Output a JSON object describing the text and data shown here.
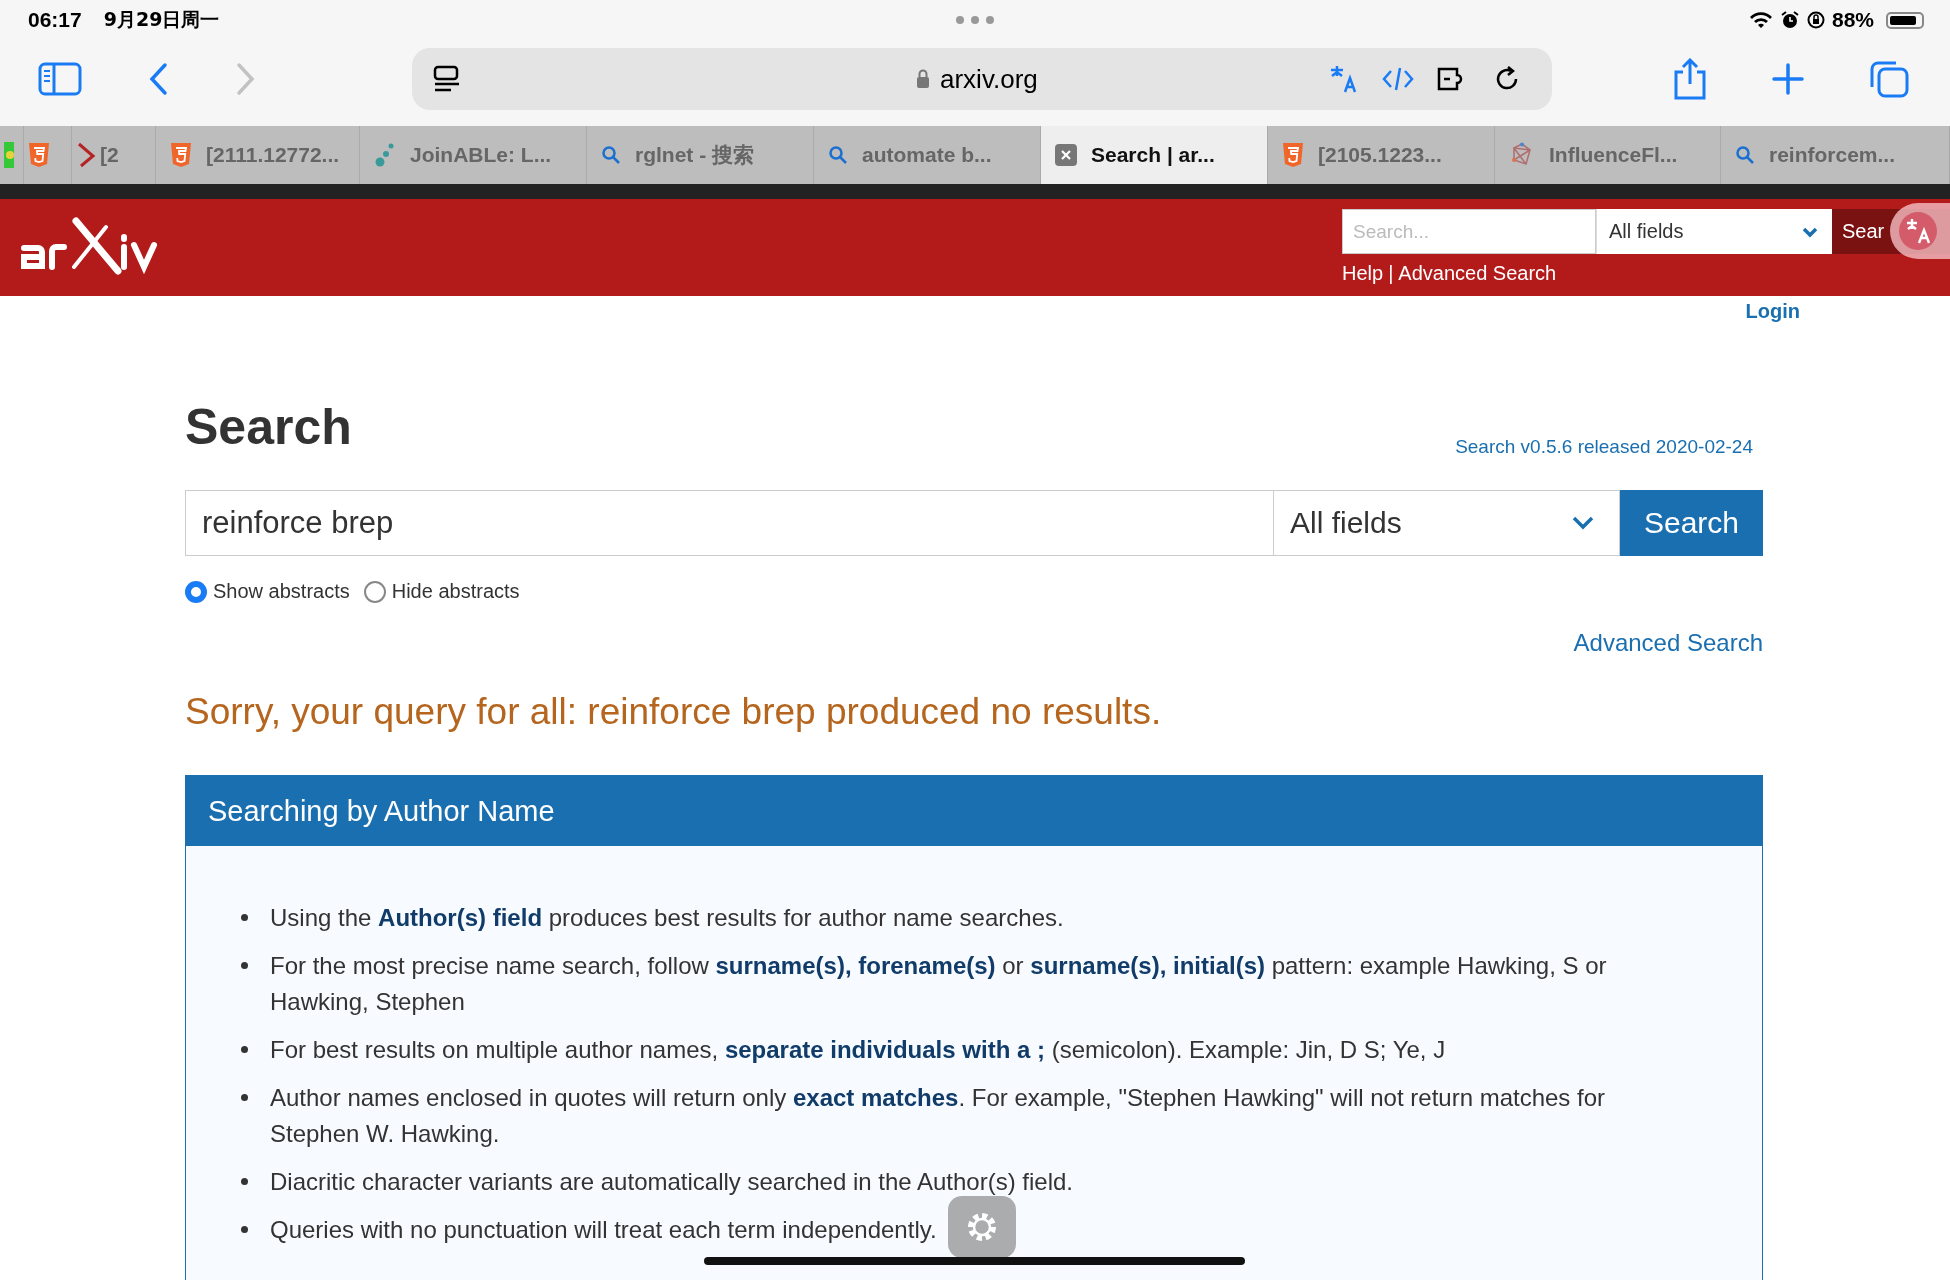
{
  "status_bar": {
    "time": "06:17",
    "date": "9月29日周一",
    "battery": "88%"
  },
  "toolbar": {
    "address": "arxiv.org"
  },
  "tabs": [
    {
      "kind": "green",
      "selected": false
    },
    {
      "kind": "html",
      "selected": false
    },
    {
      "kind": "cross",
      "label": "[2",
      "selected": false
    },
    {
      "kind": "html",
      "label": "[2111.12772...",
      "selected": false
    },
    {
      "kind": "dots",
      "label": "JoinABLe: L...",
      "selected": false
    },
    {
      "kind": "search",
      "label": "rglnet - 搜索",
      "selected": false
    },
    {
      "kind": "search",
      "label": "automate b...",
      "selected": false
    },
    {
      "kind": "close",
      "label": "Search | ar...",
      "selected": true
    },
    {
      "kind": "html",
      "label": "[2105.1223...",
      "selected": false
    },
    {
      "kind": "graph",
      "label": "InfluenceFl...",
      "selected": false
    },
    {
      "kind": "search",
      "label": "reinforcem...",
      "selected": false
    }
  ],
  "header": {
    "search_placeholder": "Search...",
    "field": "All fields",
    "button": "Sear",
    "links": [
      "Help",
      "Advanced Search"
    ],
    "separator": "|"
  },
  "login": "Login",
  "main": {
    "title": "Search",
    "version": "Search v0.5.6 released 2020-02-24",
    "query": "reinforce brep",
    "field": "All fields",
    "button": "Search",
    "radios": [
      {
        "label": "Show abstracts",
        "selected": true
      },
      {
        "label": "Hide abstracts",
        "selected": false
      }
    ],
    "advanced_link": "Advanced Search",
    "message": "Sorry, your query for all: reinforce brep produced no results.",
    "panel": {
      "title": "Searching by Author Name",
      "bullets": [
        "Using the **Author(s) field** produces best results for author name searches.",
        "For the most precise name search, follow **surname(s), forename(s)** or **surname(s), initial(s)** pattern: example Hawking, S or Hawking, Stephen",
        "For best results on multiple author names, **separate individuals with a ;** (semicolon). Example: Jin, D S; Ye, J",
        "Author names enclosed in quotes will return only **exact matches**. For example, \"Stephen Hawking\" will not return matches for Stephen W. Hawking.",
        "Diacritic character variants are automatically searched in the Author(s) field.",
        "Queries with no punctuation will treat each term independently."
      ]
    }
  }
}
